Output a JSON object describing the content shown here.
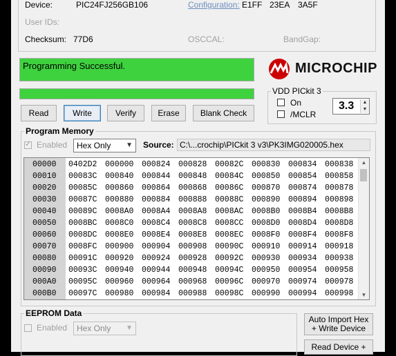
{
  "device": {
    "label": "Device:",
    "value": "PIC24FJ256GB106",
    "config_label": "Configuration:",
    "config_values": [
      "E1FF",
      "23EA",
      "3A5F"
    ],
    "userids_label": "User IDs:",
    "checksum_label": "Checksum:",
    "checksum_value": "77D6",
    "osccal_label": "OSCCAL:",
    "bandgap_label": "BandGap:"
  },
  "status": {
    "message": "Programming Successful.",
    "color": "#3fd23f",
    "progress_fraction": 1.0
  },
  "buttons": {
    "read": "Read",
    "write": "Write",
    "verify": "Verify",
    "erase": "Erase",
    "blank_check": "Blank Check"
  },
  "logo": {
    "text": "MICROCHIP",
    "color": "#cc0000"
  },
  "vdd": {
    "title": "VDD PICkit 3",
    "on_label": "On",
    "mclr_label": "/MCLR",
    "value": "3.3"
  },
  "program_memory": {
    "title": "Program Memory",
    "enabled_label": "Enabled",
    "mode": "Hex Only",
    "source_label": "Source:",
    "source_path": "C:\\...crochip\\PICkit 3 v3\\PK3IMG020005.hex",
    "rows": [
      {
        "addr": "00000",
        "cells": [
          "0402D2",
          "000000",
          "000824",
          "000828",
          "00082C",
          "000830",
          "000834",
          "000838"
        ]
      },
      {
        "addr": "00010",
        "cells": [
          "00083C",
          "000840",
          "000844",
          "000848",
          "00084C",
          "000850",
          "000854",
          "000858"
        ]
      },
      {
        "addr": "00020",
        "cells": [
          "00085C",
          "000860",
          "000864",
          "000868",
          "00086C",
          "000870",
          "000874",
          "000878"
        ]
      },
      {
        "addr": "00030",
        "cells": [
          "00087C",
          "000880",
          "000884",
          "000888",
          "00088C",
          "000890",
          "000894",
          "000898"
        ]
      },
      {
        "addr": "00040",
        "cells": [
          "00089C",
          "0008A0",
          "0008A4",
          "0008A8",
          "0008AC",
          "0008B0",
          "0008B4",
          "0008B8"
        ]
      },
      {
        "addr": "00050",
        "cells": [
          "0008BC",
          "0008C0",
          "0008C4",
          "0008C8",
          "0008CC",
          "0008D0",
          "0008D4",
          "0008D8"
        ]
      },
      {
        "addr": "00060",
        "cells": [
          "0008DC",
          "0008E0",
          "0008E4",
          "0008E8",
          "0008EC",
          "0008F0",
          "0008F4",
          "0008F8"
        ]
      },
      {
        "addr": "00070",
        "cells": [
          "0008FC",
          "000900",
          "000904",
          "000908",
          "00090C",
          "000910",
          "000914",
          "000918"
        ]
      },
      {
        "addr": "00080",
        "cells": [
          "00091C",
          "000920",
          "000924",
          "000928",
          "00092C",
          "000930",
          "000934",
          "000938"
        ]
      },
      {
        "addr": "00090",
        "cells": [
          "00093C",
          "000940",
          "000944",
          "000948",
          "00094C",
          "000950",
          "000954",
          "000958"
        ]
      },
      {
        "addr": "000A0",
        "cells": [
          "00095C",
          "000960",
          "000964",
          "000968",
          "00096C",
          "000970",
          "000974",
          "000978"
        ]
      },
      {
        "addr": "000B0",
        "cells": [
          "00097C",
          "000980",
          "000984",
          "000988",
          "00098C",
          "000990",
          "000994",
          "000998"
        ]
      }
    ]
  },
  "eeprom": {
    "title": "EEPROM Data",
    "enabled_label": "Enabled",
    "mode": "Hex Only"
  },
  "side_buttons": {
    "auto_import_line1": "Auto Import Hex",
    "auto_import_line2": "+ Write Device",
    "read_device": "Read Device +"
  }
}
